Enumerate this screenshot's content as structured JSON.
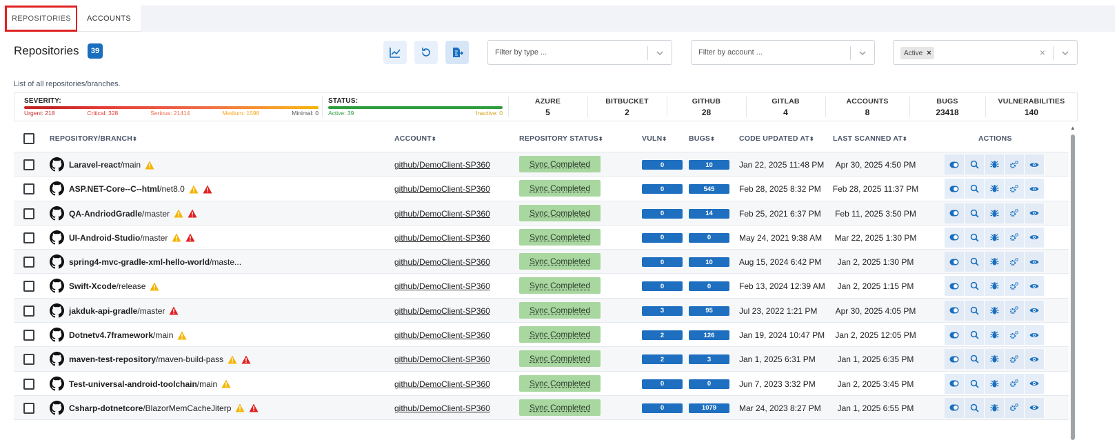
{
  "tabs": [
    {
      "label": "REPOSITORIES",
      "active": true
    },
    {
      "label": "ACCOUNTS",
      "active": false
    }
  ],
  "header": {
    "title": "Repositories",
    "count": "39",
    "subtitle": "List of all repositories/branches."
  },
  "toolbar": {
    "icons": [
      "chart-icon",
      "refresh-icon",
      "export-icon"
    ]
  },
  "filters": {
    "type_placeholder": "Filter by type ...",
    "account_placeholder": "Filter by account ...",
    "status_chip": "Active",
    "chip_remove": "×",
    "clear": "×"
  },
  "summary": {
    "severity_label": "SEVERITY:",
    "severity": {
      "urgent": "Urgent: 218",
      "critical": "Critical: 328",
      "serious": "Serious: 21414",
      "medium": "Medium: 1598",
      "minimal": "Minimal: 0"
    },
    "severity_colors": {
      "urgent": "#c62828",
      "critical": "#e53935",
      "serious": "#ef6c4a",
      "medium": "#f9a825",
      "minimal": "#555555"
    },
    "status_label": "STATUS:",
    "status": {
      "active": "Active: 39",
      "inactive": "Inactive: 0"
    },
    "status_colors": {
      "active": "#2e9e3f",
      "inactive": "#d4a017"
    },
    "metrics": [
      {
        "label": "AZURE",
        "value": "5"
      },
      {
        "label": "BITBUCKET",
        "value": "2"
      },
      {
        "label": "GITHUB",
        "value": "28"
      },
      {
        "label": "GITLAB",
        "value": "4"
      },
      {
        "label": "ACCOUNTS",
        "value": "8"
      },
      {
        "label": "BUGS",
        "value": "23418"
      },
      {
        "label": "VULNERABILITIES",
        "value": "140"
      }
    ]
  },
  "table": {
    "columns": {
      "repo": "REPOSITORY/BRANCH",
      "account": "ACCOUNT",
      "status": "REPOSITORY STATUS",
      "vuln": "VULN",
      "bugs": "BUGS",
      "code_updated": "CODE UPDATED AT",
      "last_scanned": "LAST SCANNED AT",
      "actions": "ACTIONS"
    },
    "sort_glyph": "⬍",
    "rows": [
      {
        "name": "Laravel-react",
        "branch": "/main",
        "warn": true,
        "alert": false,
        "account": "github/DemoClient-SP360",
        "status": "Sync Completed",
        "vuln": "0",
        "bugs": "10",
        "code_updated": "Jan 22, 2025 11:48 PM",
        "last_scanned": "Apr 30, 2025 4:50 PM"
      },
      {
        "name": "ASP.NET-Core--C--html",
        "branch": "/net8.0",
        "warn": true,
        "alert": true,
        "account": "github/DemoClient-SP360",
        "status": "Sync Completed",
        "vuln": "0",
        "bugs": "545",
        "code_updated": "Feb 28, 2025 8:32 PM",
        "last_scanned": "Feb 28, 2025 11:37 PM"
      },
      {
        "name": "QA-AndriodGradle",
        "branch": "/master",
        "warn": true,
        "alert": true,
        "account": "github/DemoClient-SP360",
        "status": "Sync Completed",
        "vuln": "0",
        "bugs": "14",
        "code_updated": "Feb 25, 2021 6:37 PM",
        "last_scanned": "Feb 11, 2025 3:50 PM"
      },
      {
        "name": "UI-Android-Studio",
        "branch": "/master",
        "warn": true,
        "alert": true,
        "account": "github/DemoClient-SP360",
        "status": "Sync Completed",
        "vuln": "0",
        "bugs": "0",
        "code_updated": "May 24, 2021 9:38 AM",
        "last_scanned": "Mar 22, 2025 1:30 PM"
      },
      {
        "name": "spring4-mvc-gradle-xml-hello-world",
        "branch": "/maste...",
        "warn": false,
        "alert": false,
        "account": "github/DemoClient-SP360",
        "status": "Sync Completed",
        "vuln": "0",
        "bugs": "10",
        "code_updated": "Aug 15, 2024 6:42 PM",
        "last_scanned": "Jan 2, 2025 1:30 PM"
      },
      {
        "name": "Swift-Xcode",
        "branch": "/release",
        "warn": true,
        "alert": false,
        "account": "github/DemoClient-SP360",
        "status": "Sync Completed",
        "vuln": "0",
        "bugs": "0",
        "code_updated": "Feb 13, 2024 12:39 AM",
        "last_scanned": "Jan 2, 2025 1:15 PM"
      },
      {
        "name": "jakduk-api-gradle",
        "branch": "/master",
        "warn": false,
        "alert": true,
        "account": "github/DemoClient-SP360",
        "status": "Sync Completed",
        "vuln": "3",
        "bugs": "95",
        "code_updated": "Jul 23, 2022 1:21 PM",
        "last_scanned": "Apr 30, 2025 4:05 PM"
      },
      {
        "name": "Dotnetv4.7framework",
        "branch": "/main",
        "warn": true,
        "alert": false,
        "account": "github/DemoClient-SP360",
        "status": "Sync Completed",
        "vuln": "2",
        "bugs": "126",
        "code_updated": "Jan 19, 2024 10:47 PM",
        "last_scanned": "Jan 2, 2025 12:05 PM"
      },
      {
        "name": "maven-test-repository",
        "branch": "/maven-build-pass",
        "warn": true,
        "alert": true,
        "account": "github/DemoClient-SP360",
        "status": "Sync Completed",
        "vuln": "2",
        "bugs": "3",
        "code_updated": "Jan 1, 2025 6:31 PM",
        "last_scanned": "Jan 1, 2025 6:35 PM"
      },
      {
        "name": "Test-universal-android-toolchain",
        "branch": "/main",
        "warn": true,
        "alert": false,
        "account": "github/DemoClient-SP360",
        "status": "Sync Completed",
        "vuln": "0",
        "bugs": "0",
        "code_updated": "Jun 7, 2023 3:32 PM",
        "last_scanned": "Jan 2, 2025 3:45 PM"
      },
      {
        "name": "Csharp-dotnetcore",
        "branch": "/BlazorMemCacheJiterp",
        "warn": true,
        "alert": true,
        "account": "github/DemoClient-SP360",
        "status": "Sync Completed",
        "vuln": "0",
        "bugs": "1079",
        "code_updated": "Mar 24, 2023 8:27 PM",
        "last_scanned": "Jan 1, 2025 6:55 PM"
      }
    ],
    "action_icons": [
      "toggle-icon",
      "search-icon",
      "bug-icon",
      "gears-icon",
      "eye-icon"
    ]
  },
  "colors": {
    "accent": "#1a6fbf",
    "pill": "#1e6fc0",
    "sync_bg": "#a8d7a0",
    "warn": "#f4b400",
    "alert": "#e02020",
    "tab_highlight": "#e02020"
  }
}
